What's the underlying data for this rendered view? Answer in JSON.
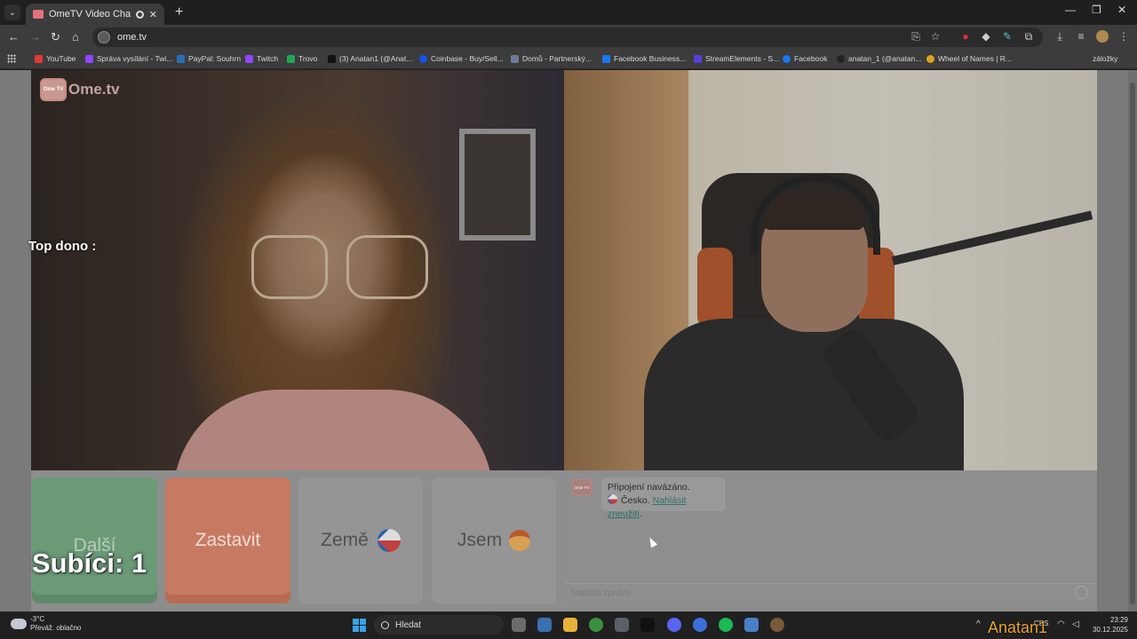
{
  "browser": {
    "tab_title": "OmeTV Video Chat — Ome",
    "tab_close": "✕",
    "new_tab": "+",
    "url": "ome.tv",
    "bookmarks": [
      {
        "label": "YouTube",
        "color": "#e53935"
      },
      {
        "label": "Správa vysílání - Twi...",
        "color": "#9146ff"
      },
      {
        "label": "PayPal: Souhrn",
        "color": "#2a6ebb"
      },
      {
        "label": "Twitch",
        "color": "#9146ff"
      },
      {
        "label": "Trovo",
        "color": "#1fa855"
      },
      {
        "label": "(3) Anatan1 (@Anat...",
        "color": "#111111"
      },
      {
        "label": "Coinbase - Buy/Sell...",
        "color": "#1652f0"
      },
      {
        "label": "Domů - Partnerský...",
        "color": "#6a7d9a"
      },
      {
        "label": "Facebook Business...",
        "color": "#1877f2"
      },
      {
        "label": "StreamElements - S...",
        "color": "#5a3fd6"
      },
      {
        "label": "Facebook",
        "color": "#1877f2"
      },
      {
        "label": "anatan_1 (@anatan...",
        "color": "#222222"
      },
      {
        "label": "Wheel of Names | R...",
        "color": "#e0a020"
      }
    ],
    "bookmarks_more": "záložky"
  },
  "page": {
    "logo_text": "Ome.tv",
    "logo_badge": "Ome TV",
    "top_dono": "Top dono :",
    "buttons": {
      "next": "Další",
      "stop": "Zastavit",
      "country": "Země",
      "gender": "Jsem"
    },
    "subs": "Subíci: 1",
    "chat": {
      "status": "Připojení navázáno.",
      "country": "Česko.",
      "report": "Nahlásit zneužití",
      "placeholder": "Napište zprávu"
    }
  },
  "taskbar": {
    "temp": "-3°C",
    "weather": "Převáž. oblačno",
    "search": "Hledat",
    "time": "23:29",
    "date": "30.12.2025",
    "watermark": "Anatan1",
    "lang": "CES"
  },
  "colors": {
    "next": "#6b9a77",
    "stop": "#c77a62",
    "accent": "#e9a32a"
  }
}
